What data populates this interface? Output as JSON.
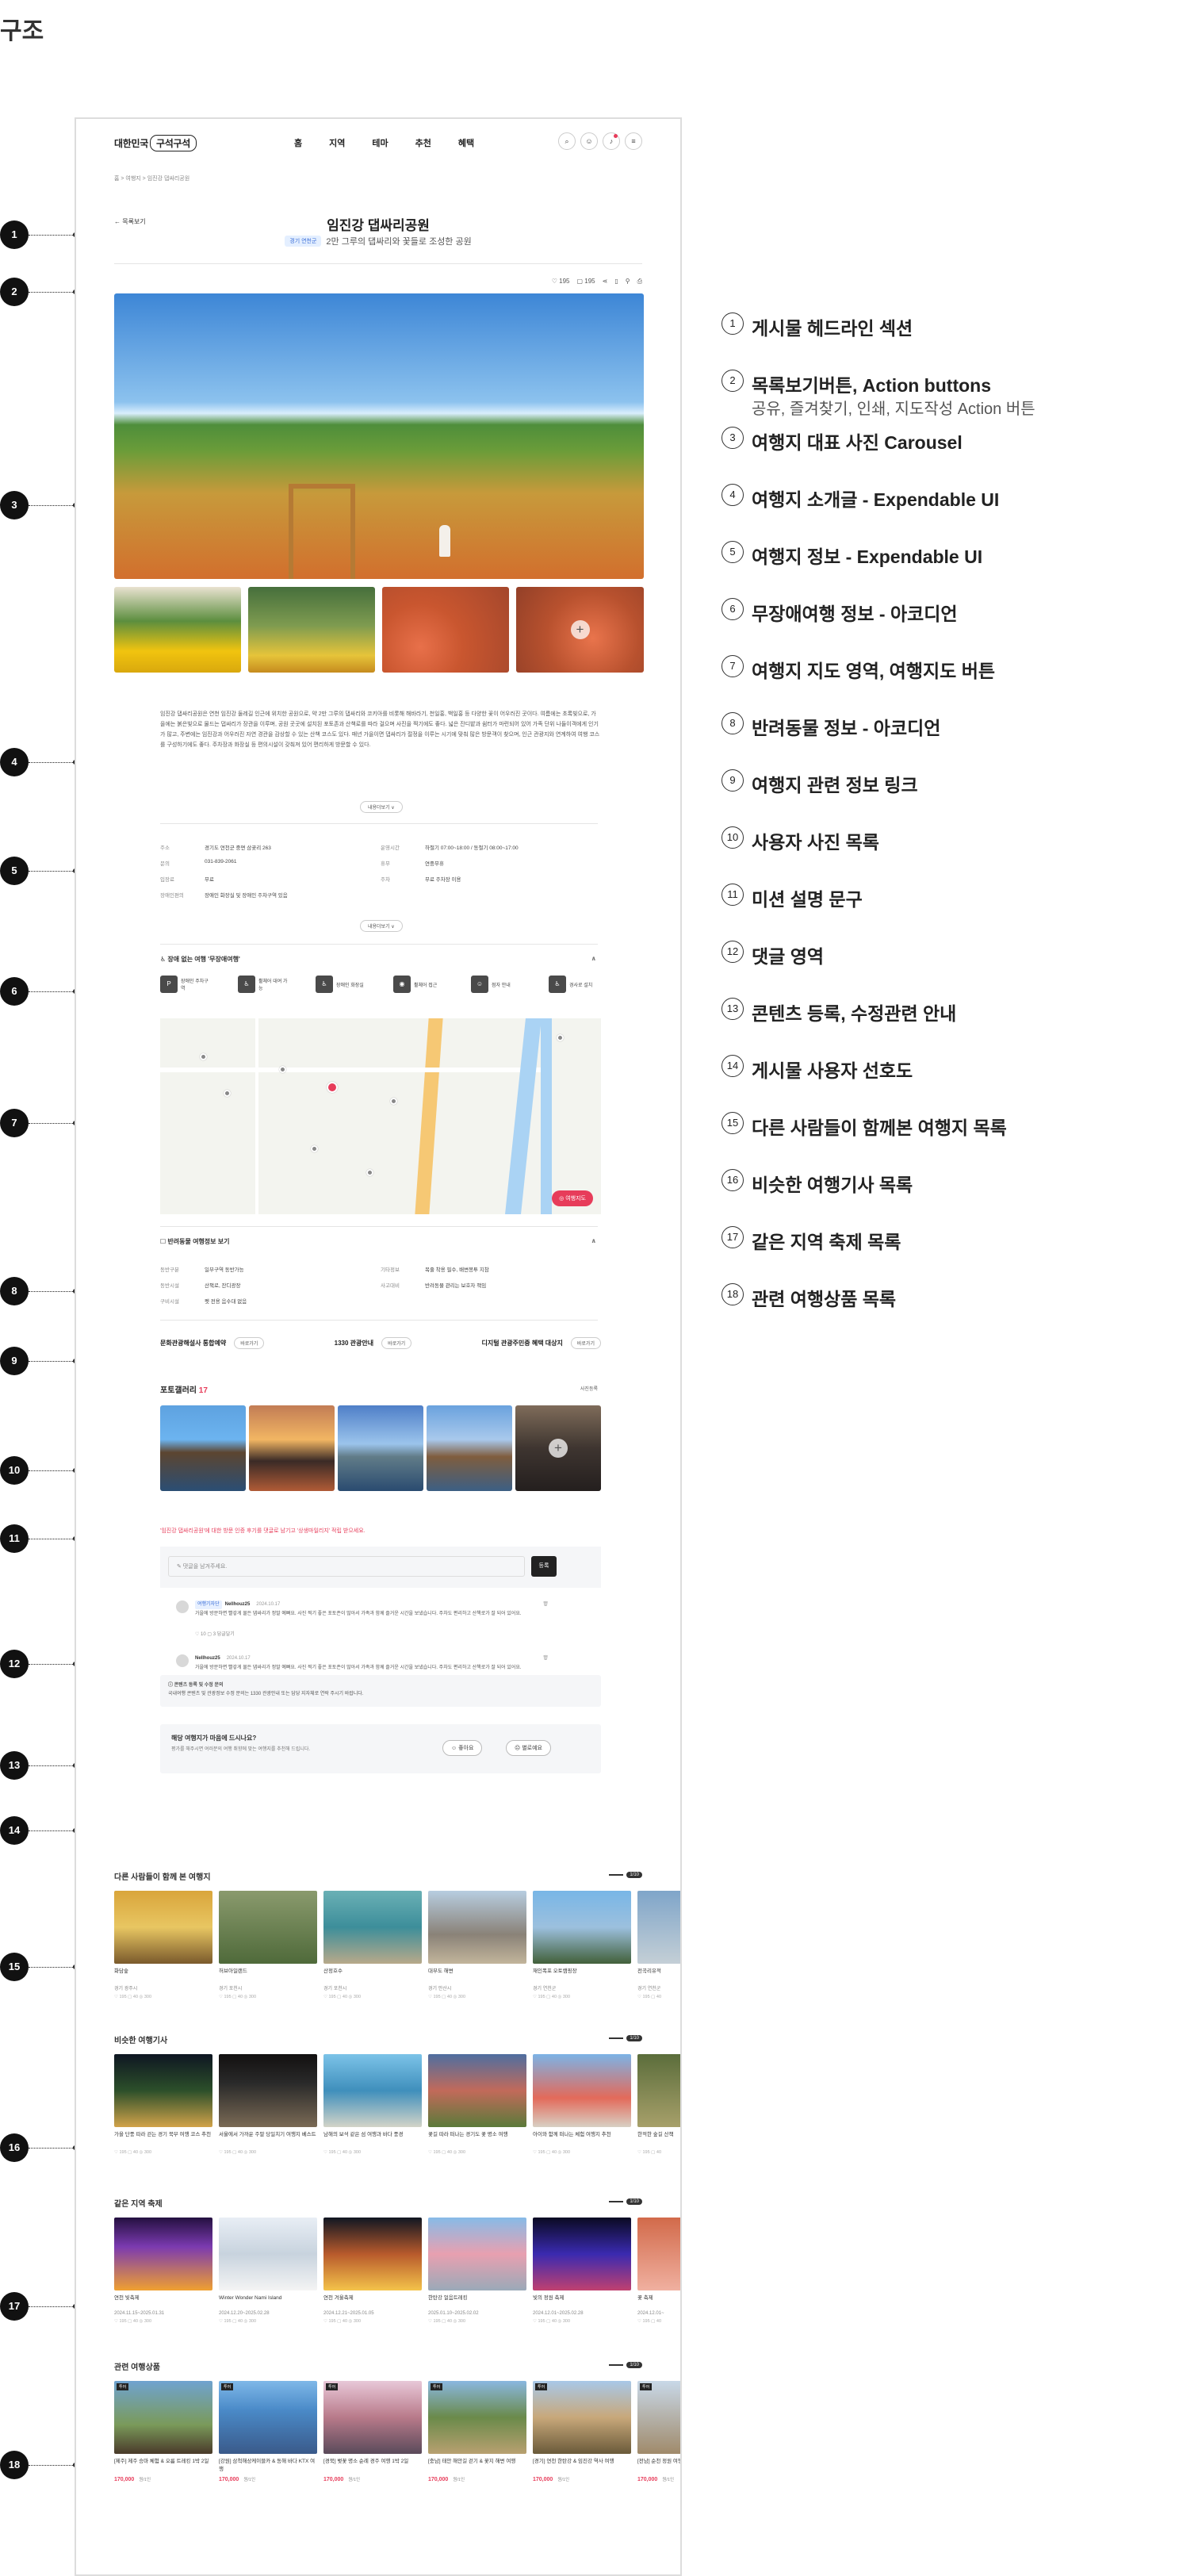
{
  "page_title": "구조",
  "header": {
    "logo_prefix": "대한민국",
    "logo_brand": "구석구석",
    "nav": [
      "홈",
      "지역",
      "테마",
      "추천",
      "혜택"
    ],
    "icons": [
      "search-icon",
      "user-icon",
      "bell-icon",
      "menu-icon"
    ]
  },
  "breadcrumb": "홈  >  여행지  >  임진강 댑싸리공원",
  "headline": {
    "back_label": "← 목록보기",
    "title": "임진강 댑싸리공원",
    "tag": "경기 연천군",
    "subtitle": "2만 그루의 댑싸리와 꽃들로 조성한 공원"
  },
  "actions": {
    "like": "♡ 195",
    "comment": "▢ 195",
    "share": "share-icon",
    "bookmark": "bookmark-icon",
    "print": "print-icon"
  },
  "intro": {
    "text": "임진강 댑싸리공원은 연천 임진강 둘레길 인근에 위치한 공원으로, 약 2만 그루의 댑싸리와 코키아를 비롯해 해바라기, 천일홍, 백일홍 등 다양한 꽃이 어우러진 곳이다. 여름에는 초록빛으로, 가을에는 붉은빛으로 물드는 댑싸리가 장관을 이루며, 공원 곳곳에 설치된 포토존과 산책로를 따라 걸으며 사진을 찍기에도 좋다. 넓은 잔디밭과 쉼터가 마련되어 있어 가족 단위 나들이객에게 인기가 많고, 주변에는 임진강과 어우러진 자연 경관을 감상할 수 있는 산책 코스도 있다. 매년 가을이면 댑싸리가 절정을 이루는 시기에 맞춰 많은 방문객이 찾으며, 인근 관광지와 연계하여 여행 코스를 구성하기에도 좋다. 주차장과 화장실 등 편의시설이 갖춰져 있어 편리하게 방문할 수 있다.",
    "more": "내용더보기 ∨"
  },
  "info": {
    "rows": [
      [
        [
          "주소",
          "경기도 연천군 중면 삼곶리 263"
        ],
        [
          "운영시간",
          "하절기 07:00~18:00 / 동절기 08:00~17:00"
        ]
      ],
      [
        [
          "문의",
          "031-839-2061"
        ],
        [
          "휴무",
          "연중무휴"
        ]
      ],
      [
        [
          "입장료",
          "무료"
        ],
        [
          "주차",
          "무료 주차장 이용"
        ]
      ],
      [
        [
          "장애인편의",
          "장애인 화장실 및 장애인 주차구역 있음"
        ],
        [
          "",
          ""
        ]
      ]
    ],
    "more": "내용더보기 ∨"
  },
  "barrier_free": {
    "title": "장애 없는 여행 '무장애여행'",
    "items": [
      {
        "icon": "P",
        "label": "장애인 주차구역"
      },
      {
        "icon": "♿",
        "label": "휠체어 대여 가능"
      },
      {
        "icon": "♿",
        "label": "장애인 화장실"
      },
      {
        "icon": "◉",
        "label": "휠체어 접근"
      },
      {
        "icon": "☺",
        "label": "점자 안내"
      },
      {
        "icon": "♿",
        "label": "경사로 설치"
      }
    ]
  },
  "map": {
    "button": "◎ 여행지도"
  },
  "pet": {
    "title": "반려동물 여행정보 보기",
    "rows": [
      [
        [
          "동반구분",
          "일부구역 동반가능"
        ],
        [
          "기타정보",
          "목줄 착용 필수, 배변봉투 지참"
        ]
      ],
      [
        [
          "동반시설",
          "산책로, 잔디광장"
        ],
        [
          "사고대비",
          "반려동물 관리는 보호자 책임"
        ]
      ],
      [
        [
          "구비시설",
          "펫 전용 음수대 없음"
        ],
        [
          "",
          ""
        ]
      ]
    ]
  },
  "links": [
    {
      "label": "문화관광해설사 통합예약",
      "btn": "바로가기"
    },
    {
      "label": "1330 관광안내",
      "btn": "바로가기"
    },
    {
      "label": "디지털 관광주민증 혜택 대상지",
      "btn": "바로가기"
    }
  ],
  "gallery": {
    "title": "포토갤러리",
    "count": "17",
    "more": "사진등록"
  },
  "mission": "'임진강 댑싸리공원'에 대한 방문 인증 후기를 댓글로 남기고 '상생마일리지' 적립 받으세요.",
  "comment_form": {
    "placeholder": "✎ 댓글을 남겨주세요.",
    "submit": "등록"
  },
  "comments": [
    {
      "badge": "여행기자단",
      "name": "Nellhouz25",
      "date": "2024.10.17",
      "text": "가을에 방문하면 빨갛게 물든 댑싸리가 정말 예뻐요. 사진 찍기 좋은 포토존이 많아서 가족과 함께 즐거운 시간을 보냈습니다. 주차도 편리하고 산책로가 잘 되어 있어요.",
      "meta": "♡ 10    ▢ 3    답글달기"
    },
    {
      "badge": "",
      "name": "Nellhouz25",
      "date": "2024.10.17",
      "text": "가을에 방문하면 빨갛게 물든 댑싸리가 정말 예뻐요. 사진 찍기 좋은 포토존이 많아서 가족과 함께 즐거운 시간을 보냈습니다. 주차도 편리하고 산책로가 잘 되어 있어요.",
      "meta": "♡ 10    ▢ 3    답글달기"
    }
  ],
  "notice": {
    "title": "ⓘ 콘텐츠 등록 및 수정 문의",
    "text": "국내여행 콘텐츠 및 관광정보 수정 문의는 1330 관광안내 또는 담당 지자체로 연락 주시기 바랍니다."
  },
  "preference": {
    "question": "해당 여행지가 마음에 드시나요?",
    "desc": "평가를 해주시면 여러분의 여행 취향에 맞는 여행지를 추천해 드립니다.",
    "like": "☺ 좋아요",
    "dislike": "☹ 별로예요"
  },
  "sections": [
    {
      "title": "다른 사람들이 함께 본 여행지",
      "page": "1/10",
      "cards": [
        {
          "name": "화담숲",
          "region": "경기 광주시",
          "meta": "♡ 195  ▢ 40  ◎ 300"
        },
        {
          "name": "허브아일랜드",
          "region": "경기 포천시",
          "meta": "♡ 195  ▢ 40  ◎ 300"
        },
        {
          "name": "산정호수",
          "region": "경기 포천시",
          "meta": "♡ 195  ▢ 40  ◎ 300"
        },
        {
          "name": "대부도 해변",
          "region": "경기 안산시",
          "meta": "♡ 195  ▢ 40  ◎ 300"
        },
        {
          "name": "재인폭포 오토캠핑장",
          "region": "경기 연천군",
          "meta": "♡ 195  ▢ 40  ◎ 300"
        },
        {
          "name": "전곡리유적",
          "region": "경기 연천군",
          "meta": "♡ 195  ▢ 40"
        }
      ]
    },
    {
      "title": "비슷한 여행기사",
      "page": "1/10",
      "cards": [
        {
          "name": "가을 단풍 따라 걷는 경기 북부 여행 코스 추천",
          "region": "",
          "meta": "♡ 195  ▢ 40  ◎ 300"
        },
        {
          "name": "서울에서 가까운 주말 당일치기 여행지 베스트",
          "region": "",
          "meta": "♡ 195  ▢ 40  ◎ 300"
        },
        {
          "name": "남해의 보석 같은 섬 여행과 바다 풍경",
          "region": "",
          "meta": "♡ 195  ▢ 40  ◎ 300"
        },
        {
          "name": "꽃길 따라 떠나는 경기도 꽃 명소 여행",
          "region": "",
          "meta": "♡ 195  ▢ 40  ◎ 300"
        },
        {
          "name": "아이와 함께 떠나는 체험 여행지 추천",
          "region": "",
          "meta": "♡ 195  ▢ 40  ◎ 300"
        },
        {
          "name": "한적한 숲길 산책",
          "region": "",
          "meta": "♡ 195  ▢ 40"
        }
      ]
    },
    {
      "title": "같은 지역 축제",
      "page": "1/10",
      "cards": [
        {
          "name": "연천 빛축제",
          "region": "2024.11.15~2025.01.31",
          "meta": "♡ 195  ▢ 40  ◎ 300"
        },
        {
          "name": "Winter Wonder Nami Island",
          "region": "2024.12.20~2025.02.28",
          "meta": "♡ 195  ▢ 40  ◎ 300"
        },
        {
          "name": "연천 겨울축제",
          "region": "2024.12.21~2025.01.05",
          "meta": "♡ 195  ▢ 40  ◎ 300"
        },
        {
          "name": "한탄강 얼음트레킹",
          "region": "2025.01.10~2025.02.02",
          "meta": "♡ 195  ▢ 40  ◎ 300"
        },
        {
          "name": "빛의 정원 축제",
          "region": "2024.12.01~2025.02.28",
          "meta": "♡ 195  ▢ 40  ◎ 300"
        },
        {
          "name": "꽃 축제",
          "region": "2024.12.01~",
          "meta": "♡ 195  ▢ 40"
        }
      ]
    },
    {
      "title": "관련 여행상품",
      "page": "1/10",
      "cards": [
        {
          "name": "[제주] 제주 승마 체험 & 오름 트레킹 1박 2일",
          "region": "",
          "price": "170,000",
          "unit": "원/1인",
          "label": "투어"
        },
        {
          "name": "[강원] 삼척해상케이블카 & 동해 바다 KTX 여행",
          "region": "",
          "price": "170,000",
          "unit": "원/1인",
          "label": "투어"
        },
        {
          "name": "[경북] 벚꽃 명소 순례 경주 여행 1박 2일",
          "region": "",
          "price": "170,000",
          "unit": "원/1인",
          "label": "투어"
        },
        {
          "name": "[충남] 태안 해안길 걷기 & 꽃지 해변 여행",
          "region": "",
          "price": "170,000",
          "unit": "원/1인",
          "label": "투어"
        },
        {
          "name": "[경기] 연천 한탄강 & 임진강 역사 여행",
          "region": "",
          "price": "170,000",
          "unit": "원/1인",
          "label": "투어"
        },
        {
          "name": "[전남] 순천 정원 여행",
          "region": "",
          "price": "170,000",
          "unit": "원/1인",
          "label": "투어"
        }
      ]
    }
  ],
  "legend": [
    {
      "n": "1",
      "label": "게시물 헤드라인 섹션"
    },
    {
      "n": "2",
      "label": "목록보기버튼, Action buttons",
      "sub": "공유, 즐겨찾기, 인쇄, 지도작성 Action 버튼"
    },
    {
      "n": "3",
      "label": "여행지 대표 사진 Carousel"
    },
    {
      "n": "4",
      "label": "여행지 소개글 - Expendable UI"
    },
    {
      "n": "5",
      "label": "여행지 정보 - Expendable UI"
    },
    {
      "n": "6",
      "label": "무장애여행 정보 - 아코디언"
    },
    {
      "n": "7",
      "label": "여행지 지도 영역, 여행지도 버튼"
    },
    {
      "n": "8",
      "label": "반려동물 정보 - 아코디언"
    },
    {
      "n": "9",
      "label": "여행지 관련 정보 링크"
    },
    {
      "n": "10",
      "label": "사용자 사진 목록"
    },
    {
      "n": "11",
      "label": "미션 설명 문구"
    },
    {
      "n": "12",
      "label": "댓글 영역"
    },
    {
      "n": "13",
      "label": "콘텐츠 등록, 수정관련 안내"
    },
    {
      "n": "14",
      "label": "게시물 사용자 선호도"
    },
    {
      "n": "15",
      "label": "다른 사람들이 함께본 여행지 목록"
    },
    {
      "n": "16",
      "label": "비슷한 여행기사 목록"
    },
    {
      "n": "17",
      "label": "같은 지역 축제 목록"
    },
    {
      "n": "18",
      "label": "관련 여행상품 목록"
    }
  ],
  "markers": [
    "1",
    "2",
    "3",
    "4",
    "5",
    "6",
    "7",
    "8",
    "9",
    "10",
    "11",
    "12",
    "13",
    "14",
    "15",
    "16",
    "17",
    "18"
  ]
}
